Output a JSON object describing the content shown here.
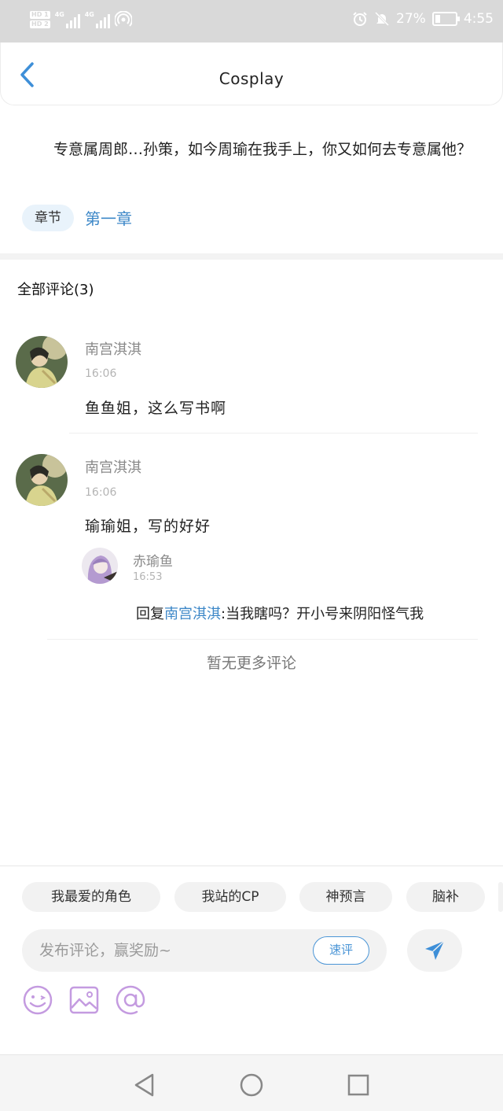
{
  "status_bar": {
    "left_labels": [
      "HD",
      "HD"
    ],
    "sim_badges": [
      "1",
      "2"
    ],
    "network": [
      "4G",
      "4G"
    ],
    "battery_percent": "27%",
    "battery_level": 0.27,
    "time": "4:55",
    "icons": [
      "signal-icon",
      "wifi-hotspot-icon",
      "alarm-icon",
      "mute-icon",
      "battery-charging-icon"
    ]
  },
  "header": {
    "back_icon": "chevron-left-icon",
    "title": "Cosplay"
  },
  "intro": {
    "text": "专意属周郎…孙策，如今周瑜在我手上，你又如何去专意属他？",
    "chapter_tag": "章节",
    "chapter_link": "第一章"
  },
  "comments": {
    "title": "全部评论(3)",
    "items": [
      {
        "name": "南宫淇淇",
        "time": "16:06",
        "text": "鱼鱼姐，这么写书啊"
      },
      {
        "name": "南宫淇淇",
        "time": "16:06",
        "text": "瑜瑜姐，写的好好",
        "reply": {
          "name": "赤瑜鱼",
          "time": "16:53",
          "prefix": "回复",
          "mention": "南宫淇淇",
          "colon": ":",
          "text": "当我瞎吗？开小号来阴阳怪气我"
        }
      }
    ],
    "no_more": "暂无更多评论"
  },
  "composer": {
    "chips": [
      "我最爱的角色",
      "我站的CP",
      "神预言",
      "脑补"
    ],
    "placeholder": "发布评论，赢奖励~",
    "quick_review": "速评",
    "send_icon": "send-icon",
    "tools": [
      "emoji-icon",
      "image-icon",
      "at-icon"
    ],
    "accent": "#4a95d6"
  },
  "nav_bar": {
    "icons": [
      "back-triangle-icon",
      "home-circle-icon",
      "recents-square-icon"
    ]
  },
  "colors": {
    "link": "#3e88c8",
    "status_bar_bg": "#d9d9d9",
    "tool_icon": "#c49be0"
  }
}
